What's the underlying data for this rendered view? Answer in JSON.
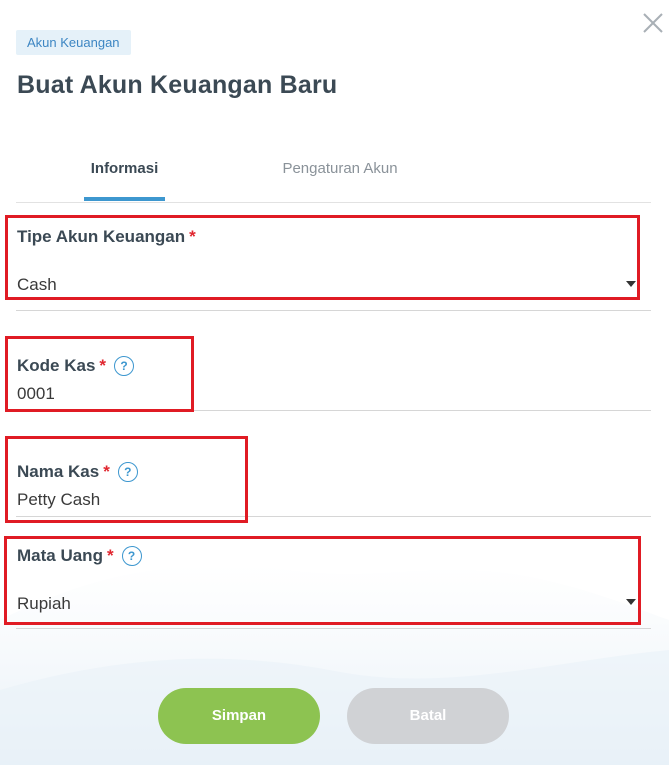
{
  "breadcrumb": "Akun Keuangan",
  "title": "Buat Akun Keuangan Baru",
  "tabs": [
    {
      "label": "Informasi",
      "active": true
    },
    {
      "label": "Pengaturan Akun",
      "active": false
    }
  ],
  "fields": {
    "account_type": {
      "label": "Tipe Akun Keuangan",
      "required": "*",
      "value": "Cash"
    },
    "cash_code": {
      "label": "Kode Kas",
      "required": "*",
      "help": "?",
      "value": "0001"
    },
    "cash_name": {
      "label": "Nama Kas",
      "required": "*",
      "help": "?",
      "value": "Petty Cash"
    },
    "currency": {
      "label": "Mata Uang",
      "required": "*",
      "help": "?",
      "value": "Rupiah"
    }
  },
  "buttons": {
    "save": "Simpan",
    "cancel": "Batal"
  },
  "colors": {
    "accent": "#3d97cf",
    "required": "#e01b24",
    "save": "#8dc351",
    "cancel": "#d0d2d5"
  }
}
